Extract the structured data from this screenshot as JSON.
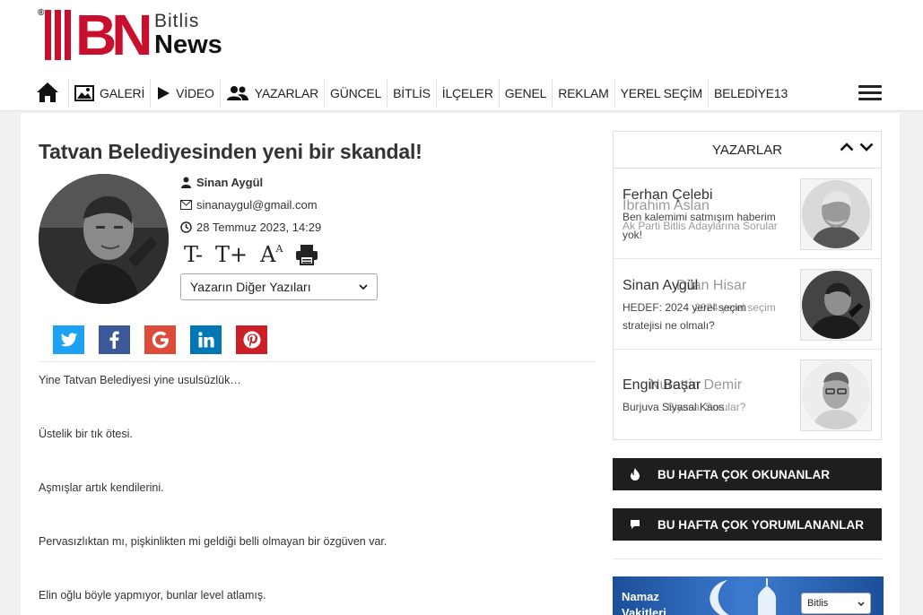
{
  "logo": {
    "registered": "®",
    "mark": "BN",
    "line1": "Bitlis",
    "line2": "News"
  },
  "nav": {
    "items": [
      {
        "label": "GALERİ",
        "icon": "image-icon"
      },
      {
        "label": "VİDEO",
        "icon": "play-icon"
      },
      {
        "label": "YAZARLAR",
        "icon": "users-icon"
      },
      {
        "label": "GÜNCEL"
      },
      {
        "label": "BİTLİS"
      },
      {
        "label": "İLÇELER"
      },
      {
        "label": "GENEL"
      },
      {
        "label": "REKLAM"
      },
      {
        "label": "YEREL SEÇİM"
      },
      {
        "label": "BELEDİYE13"
      }
    ]
  },
  "article": {
    "title": "Tatvan Belediyesinden yeni bir skandal!",
    "author": "Sinan Aygül",
    "email": "sinanaygul@gmail.com",
    "date": "28 Temmuz 2023, 14:29",
    "tools": {
      "decrease": "T-",
      "increase": "T+",
      "font": "A"
    },
    "other_posts_select": "Yazarın Diğer Yazıları",
    "paragraphs": [
      "Yine Tatvan Belediyesi yine usulsüzlük…",
      "Üstelik bir tık ötesi.",
      "Aşmışlar artık kendilerini.",
      "Pervasızlıktan mı, pişkinlikten mi geldiği belli olmayan bir özgüven var.",
      "Elin oğlu böyle yapmıyor, bunlar level atlamış."
    ]
  },
  "share": [
    {
      "name": "twitter",
      "color": "#1da1f2"
    },
    {
      "name": "facebook",
      "color": "#3b5998"
    },
    {
      "name": "google",
      "color": "#dd4b39"
    },
    {
      "name": "linkedin",
      "color": "#0077b5"
    },
    {
      "name": "pinterest",
      "color": "#cb2027"
    }
  ],
  "sidebar": {
    "yazarlar_title": "YAZARLAR",
    "writers": [
      {
        "ghost_name": "İbrahim Aslan",
        "ghost_text": "Ak Parti Bitlis Adaylarına Sorular",
        "name": "Ferhan Çelebi",
        "text_line1": "Ben kalemimi satmışım haberim",
        "text_line2": "yok!"
      },
      {
        "ghost_name": "Dilan Hisar",
        "ghost_text": "2024 yerel seçim",
        "name": "Sinan Aygül",
        "text_line1": "HEDEF: 2024 yerel seçim",
        "text_line2": "stratejisi ne olmalı?"
      },
      {
        "ghost_name": "Nurettin Demir",
        "ghost_text": "Siyasal Sorular?",
        "name": "Engin Başar",
        "text_line1": "Burjuva Siyasal Kaos",
        "text_line2": ""
      }
    ],
    "most_read": "BU HAFTA ÇOK OKUNANLAR",
    "most_commented": "BU HAFTA ÇOK YORUMLANANLAR",
    "namaz_line1": "Namaz",
    "namaz_line2": "Vakitleri",
    "namaz_city": "Bitlis"
  }
}
